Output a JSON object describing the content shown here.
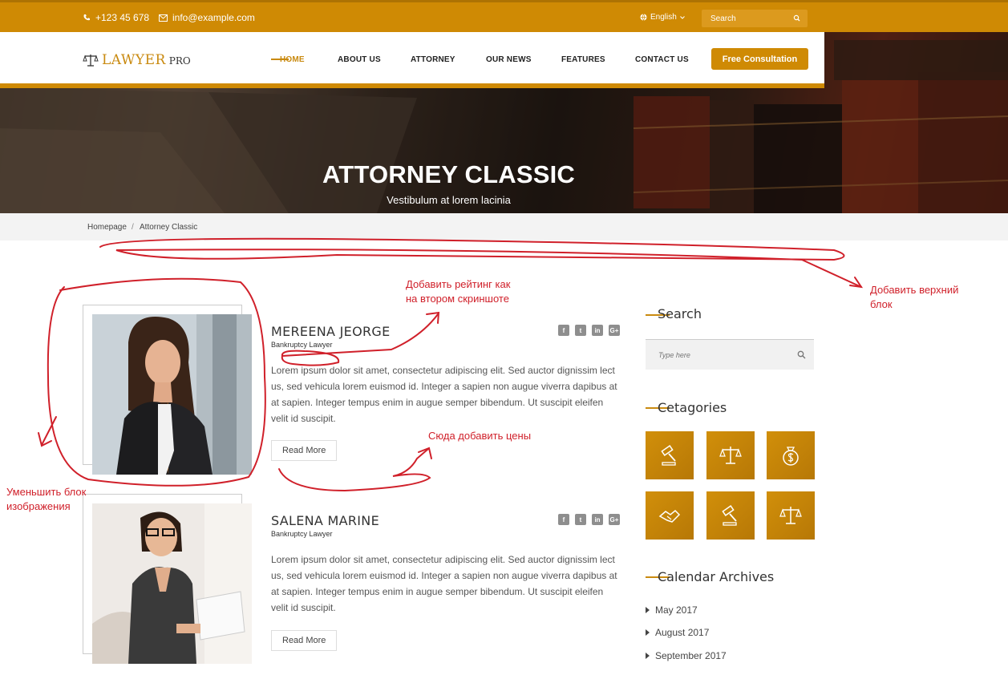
{
  "topbar": {
    "phone": "+123 45 678",
    "email": "info@example.com",
    "language": "English",
    "search_placeholder": "Search"
  },
  "header": {
    "logo_name": "LAWYER",
    "logo_suffix": "PRO",
    "nav": [
      "HOME",
      "ABOUT US",
      "ATTORNEY",
      "OUR NEWS",
      "FEATURES",
      "CONTACT US"
    ],
    "active_nav": "HOME",
    "cta_label": "Free Consultation"
  },
  "hero": {
    "title": "ATTORNEY CLASSIC",
    "subtitle": "Vestibulum at lorem lacinia"
  },
  "breadcrumb": {
    "home": "Homepage",
    "separator": "/",
    "current": "Attorney Classic"
  },
  "attorneys": [
    {
      "name": "MEREENA JEORGE",
      "role": "Bankruptcy Lawyer",
      "lines": [
        "Lorem ipsum dolor sit amet, consectetur adipiscing elit. Sed auctor dignissim lect",
        "us, sed vehicula lorem euismod id. Integer a sapien non augue viverra dapibus at",
        "at sapien. Integer tempus enim in augue semper bibendum. Ut suscipit eleifen",
        "velit id suscipit."
      ],
      "button": "Read More"
    },
    {
      "name": "SALENA MARINE",
      "role": "Bankruptcy Lawyer",
      "lines": [
        "Lorem ipsum dolor sit amet, consectetur adipiscing elit. Sed auctor dignissim lect",
        "us, sed vehicula lorem euismod id. Integer a sapien non augue viverra dapibus at",
        "at sapien. Integer tempus enim in augue semper bibendum. Ut suscipit eleifen",
        "velit id suscipit."
      ],
      "button": "Read More"
    }
  ],
  "social_icons": [
    "facebook-icon",
    "twitter-icon",
    "linkedin-icon",
    "google-plus-icon"
  ],
  "social_glyphs": [
    "f",
    "t",
    "in",
    "G+"
  ],
  "sidebar": {
    "search_title": "Search",
    "search_placeholder": "Type here",
    "categories_title": "Cetagories",
    "category_icons": [
      "gavel-icon",
      "scales-icon",
      "money-bag-icon",
      "handshake-icon",
      "gavel-icon",
      "scales-icon"
    ],
    "archives_title": "Calendar Archives",
    "archives": [
      "May 2017",
      "August 2017",
      "September 2017"
    ]
  },
  "annotations": {
    "rating": [
      "Добавить рейтинг как",
      "на втором скриншоте"
    ],
    "top_block": [
      "Добавить верхний",
      "блок"
    ],
    "prices": "Сюда добавить цены",
    "shrink_image": [
      "Уменьшить блок",
      "изображения"
    ]
  },
  "colors": {
    "brand": "#cf8a04",
    "annotation": "#d0202a"
  }
}
